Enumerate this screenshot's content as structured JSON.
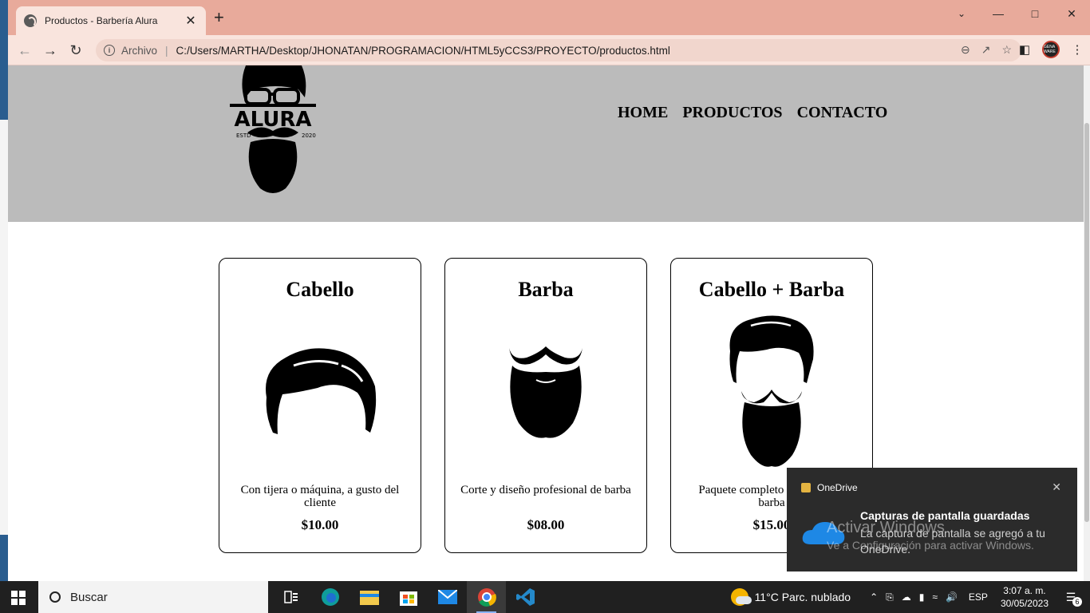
{
  "browser": {
    "tab_title": "Productos - Barbería Alura",
    "tab_close": "✕",
    "new_tab": "+",
    "scheme_label": "Archivo",
    "url": "C:/Users/MARTHA/Desktop/JHONATAN/PROGRAMACION/HTML5yCCS3/PROYECTO/productos.html",
    "profile_label": "GENA WARE"
  },
  "site": {
    "logo_text": "ALURA",
    "logo_estd": "ESTD",
    "logo_year": "2020",
    "nav": [
      "HOME",
      "PRODUCTOS",
      "CONTACTO"
    ]
  },
  "products": [
    {
      "title": "Cabello",
      "description": "Con tijera o máquina, a gusto del cliente",
      "price": "$10.00",
      "icon": "hair-icon"
    },
    {
      "title": "Barba",
      "description": "Corte y diseño profesional de barba",
      "price": "$08.00",
      "icon": "beard-icon"
    },
    {
      "title": "Cabello + Barba",
      "description": "Paquete completo de cabello y barba",
      "price": "$15.00",
      "icon": "hair-beard-icon"
    }
  ],
  "toast": {
    "app": "OneDrive",
    "title": "Capturas de pantalla guardadas",
    "body": "La captura de pantalla se agregó a tu OneDrive.",
    "close": "✕"
  },
  "watermark": {
    "line1": "Activar Windows",
    "line2": "Ve a Configuración para activar Windows."
  },
  "taskbar": {
    "search_placeholder": "Buscar",
    "weather": "11°C  Parc. nublado",
    "lang": "ESP",
    "time": "3:07 a. m.",
    "date": "30/05/2023",
    "notifications": "6"
  }
}
